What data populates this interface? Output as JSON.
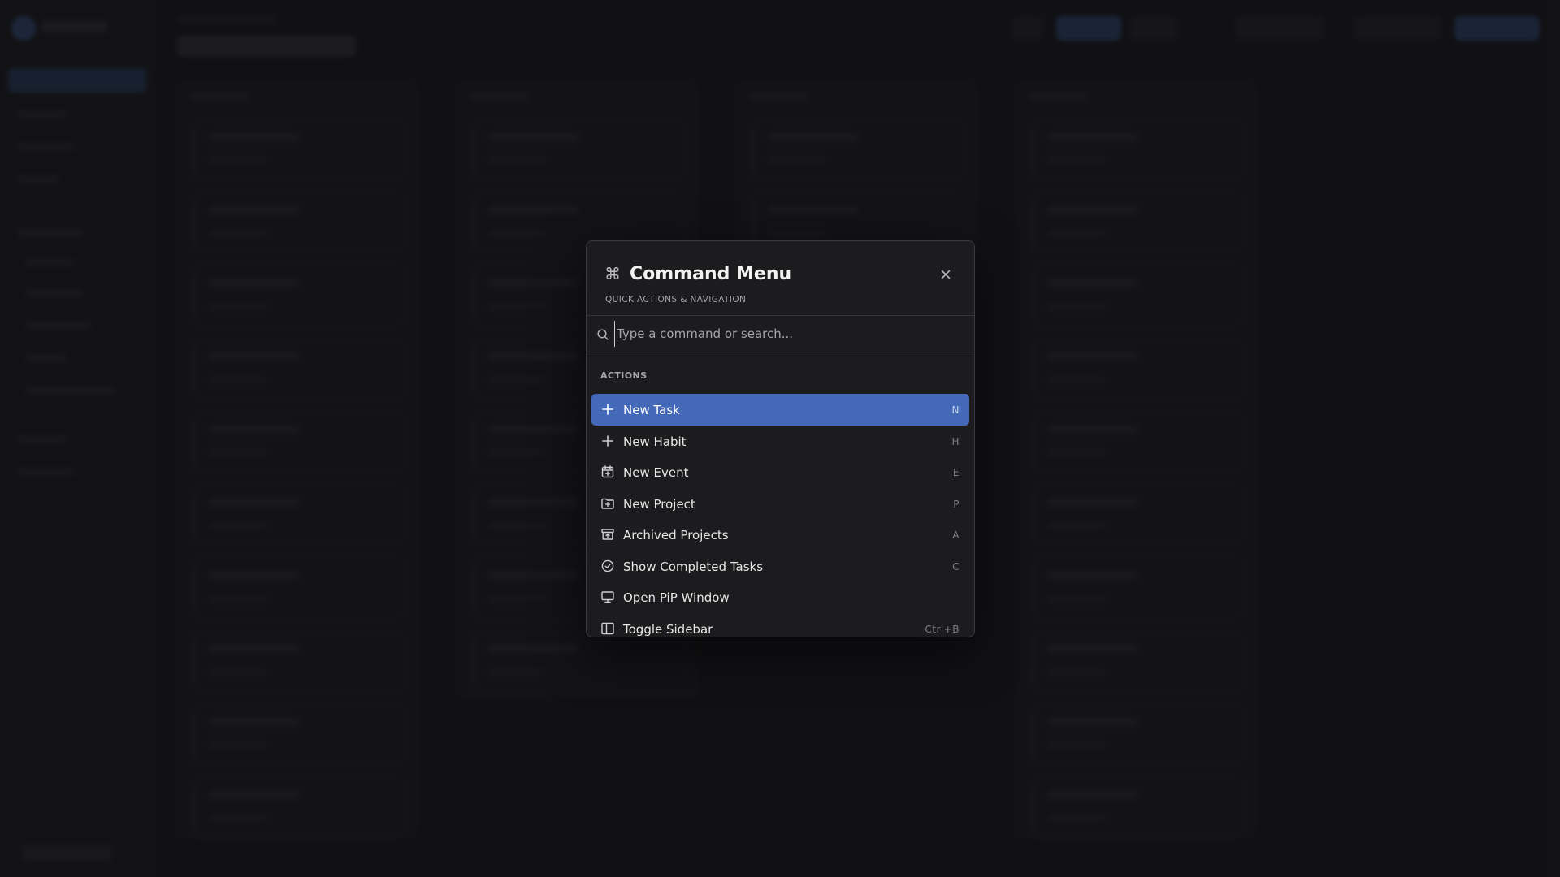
{
  "dialog": {
    "title": "Command Menu",
    "subtitle": "QUICK ACTIONS & NAVIGATION",
    "search_placeholder": "Type a command or search...",
    "search_value": "",
    "section_label": "ACTIONS",
    "items": [
      {
        "label": "New Task",
        "shortcut": "N",
        "icon": "plus-icon",
        "active": true
      },
      {
        "label": "New Habit",
        "shortcut": "H",
        "icon": "plus-icon",
        "active": false
      },
      {
        "label": "New Event",
        "shortcut": "E",
        "icon": "calendar-plus-icon",
        "active": false
      },
      {
        "label": "New Project",
        "shortcut": "P",
        "icon": "folder-plus-icon",
        "active": false
      },
      {
        "label": "Archived Projects",
        "shortcut": "A",
        "icon": "archive-icon",
        "active": false
      },
      {
        "label": "Show Completed Tasks",
        "shortcut": "C",
        "icon": "check-circle-icon",
        "active": false
      },
      {
        "label": "Open PiP Window",
        "shortcut": "",
        "icon": "monitor-icon",
        "active": false
      },
      {
        "label": "Toggle Sidebar",
        "shortcut": "Ctrl+B",
        "icon": "sidebar-icon",
        "active": false
      }
    ]
  },
  "colors": {
    "accent": "#4469b8",
    "dialog_bg": "#1c1c1e",
    "page_bg": "#17171a"
  }
}
